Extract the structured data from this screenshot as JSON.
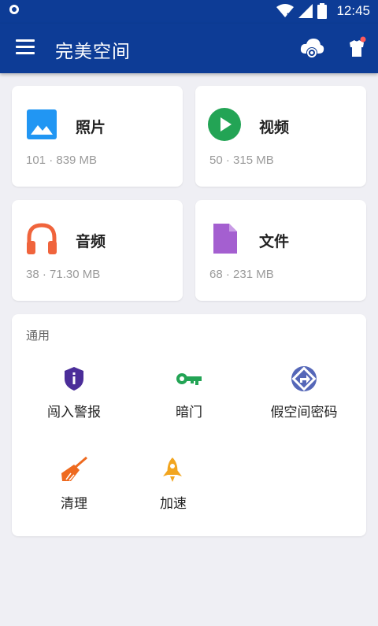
{
  "status_bar": {
    "time": "12:45"
  },
  "app_bar": {
    "title": "完美空间"
  },
  "categories": [
    {
      "name": "照片",
      "meta": "101 · 839 MB",
      "icon": "image-icon",
      "color": "#2196f3"
    },
    {
      "name": "视频",
      "meta": "50 · 315 MB",
      "icon": "play-icon",
      "color": "#23a455"
    },
    {
      "name": "音频",
      "meta": "38 · 71.30 MB",
      "icon": "headphones-icon",
      "color": "#f0643c"
    },
    {
      "name": "文件",
      "meta": "68 · 231 MB",
      "icon": "document-icon",
      "color": "#a45fd0"
    }
  ],
  "general": {
    "header": "通用",
    "tools": [
      {
        "label": "闯入警报",
        "icon": "shield-alert-icon",
        "color": "#4b2d99"
      },
      {
        "label": "暗门",
        "icon": "key-icon",
        "color": "#23a455"
      },
      {
        "label": "假空间密码",
        "icon": "directions-icon",
        "color": "#5567b8"
      },
      {
        "label": "清理",
        "icon": "broom-icon",
        "color": "#ee6a1f"
      },
      {
        "label": "加速",
        "icon": "rocket-icon",
        "color": "#f2a51f"
      }
    ]
  }
}
